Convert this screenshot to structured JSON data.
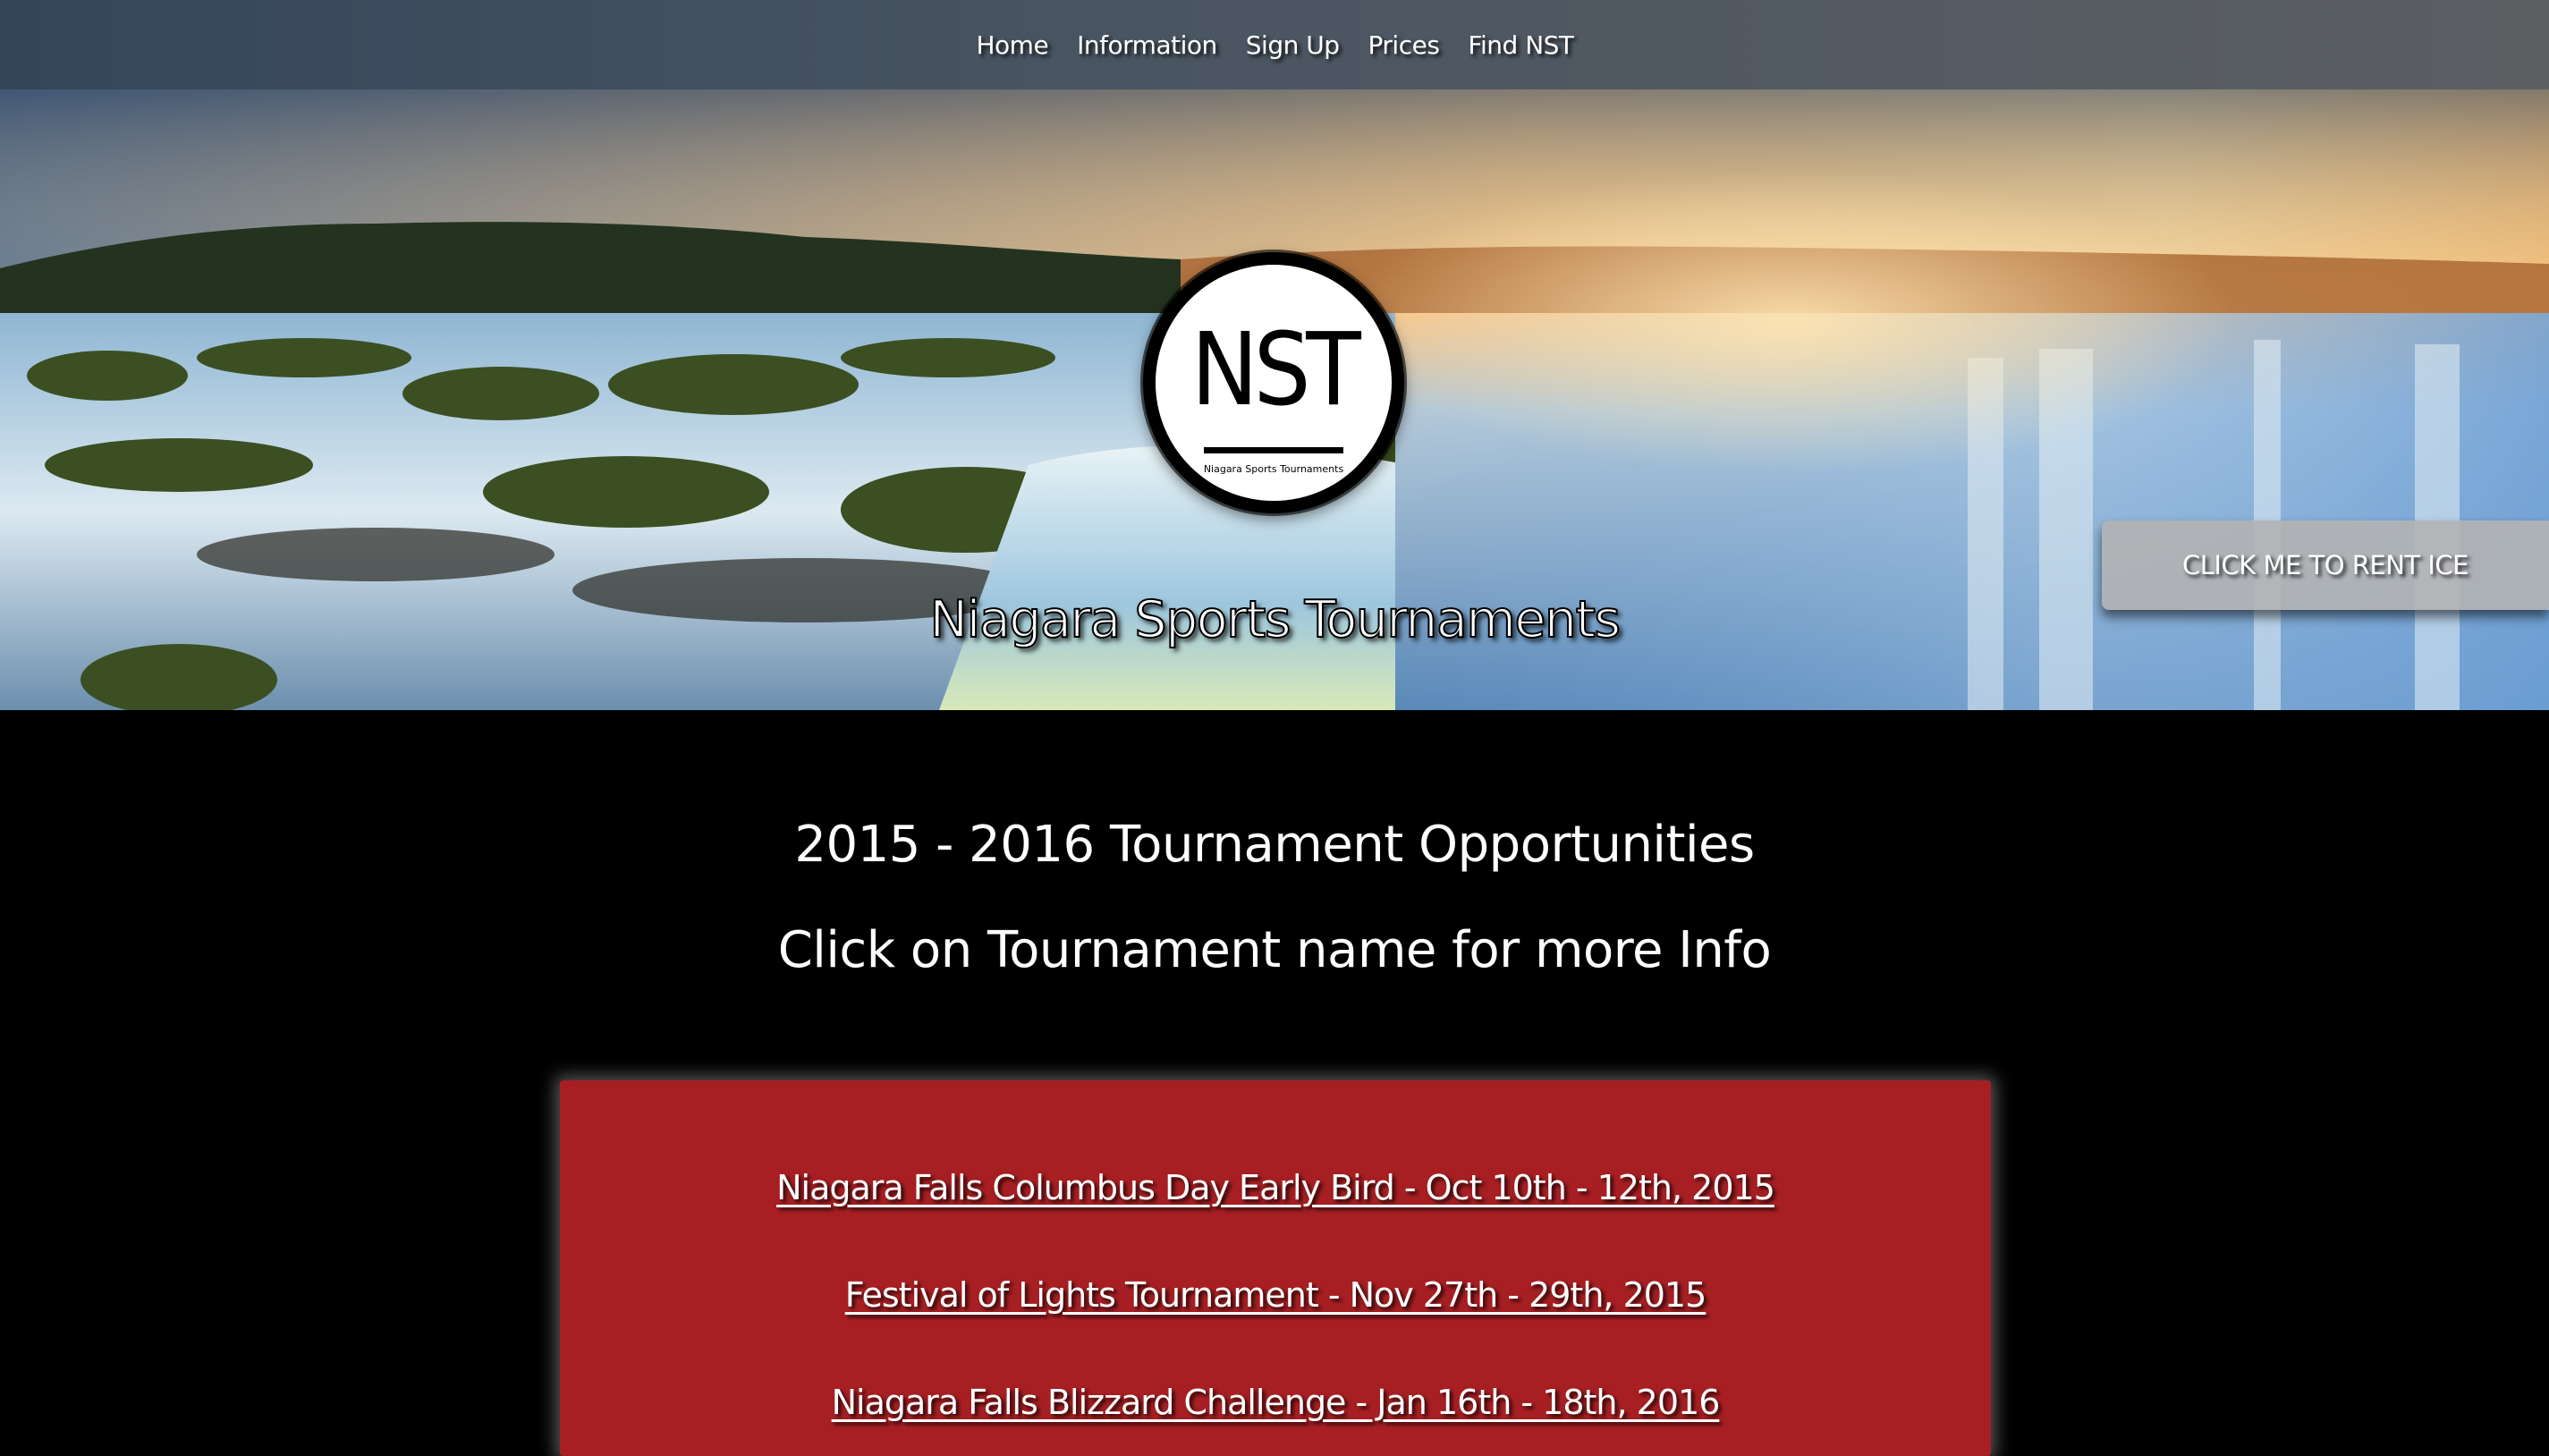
{
  "nav": {
    "items": [
      {
        "label": "Home"
      },
      {
        "label": "Information"
      },
      {
        "label": "Sign Up"
      },
      {
        "label": "Prices"
      },
      {
        "label": "Find NST"
      }
    ]
  },
  "hero": {
    "logo_mark": "NST",
    "logo_subtitle": "Niagara Sports Tournaments",
    "title": "Niagara Sports Tournaments",
    "rent_button": "CLICK ME TO RENT ICE"
  },
  "main": {
    "heading": "2015 - 2016 Tournament Opportunities",
    "subheading": "Click on Tournament name for more Info",
    "tournaments": [
      {
        "label": "Niagara Falls Columbus Day Early Bird - Oct 10th - 12th, 2015"
      },
      {
        "label": "Festival of Lights Tournament - Nov 27th - 29th, 2015"
      },
      {
        "label": "Niagara Falls Blizzard Challenge - Jan 16th - 18th, 2016"
      }
    ]
  },
  "colors": {
    "nav_bg": "#4a5562",
    "tournament_box": "#a71f23",
    "rent_button_bg": "#b2b2b2",
    "page_bg": "#000000"
  }
}
